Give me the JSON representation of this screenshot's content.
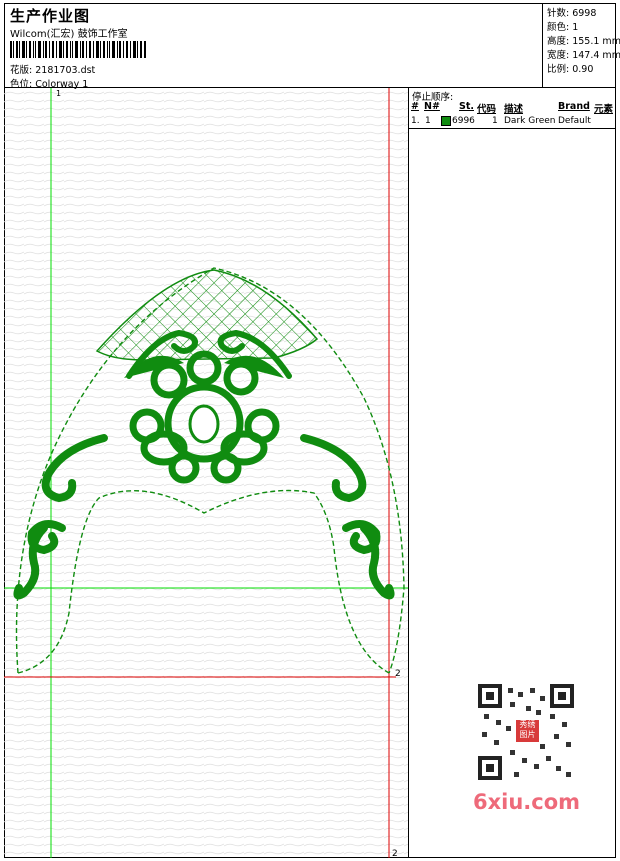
{
  "header": {
    "title": "生产作业图",
    "studio": "Wilcom(汇宏) 鼓饰工作室",
    "file_label": "花版:",
    "file_name": "2181703.dst",
    "colorway_label": "色位:",
    "colorway_name": "Colorway 1"
  },
  "stats": {
    "stitches": "针数: 6998",
    "colors": "颜色: 1",
    "height": "高度: 155.1 mm",
    "width": "宽度: 147.4 mm",
    "scale": "比例: 0.90"
  },
  "stop_sequence": {
    "title": "停止顺序:",
    "headers": [
      "#",
      "N#",
      "St.",
      "代码",
      "描述",
      "Brand",
      "元素"
    ],
    "rows": [
      {
        "num": "1.",
        "needle": "1",
        "stitches": "6996",
        "code": "1",
        "description": "Dark Green",
        "brand": "Default",
        "color": "#108c10"
      }
    ]
  },
  "guides": {
    "top_marker": "1",
    "right_marker": "2",
    "bottom_marker": "2"
  },
  "watermark": {
    "site": "6xiu.com",
    "seal": "秀绣图片"
  },
  "colors": {
    "stitch": "#108c10",
    "guide_green": "#00dd00",
    "guide_red": "#dd0000"
  }
}
